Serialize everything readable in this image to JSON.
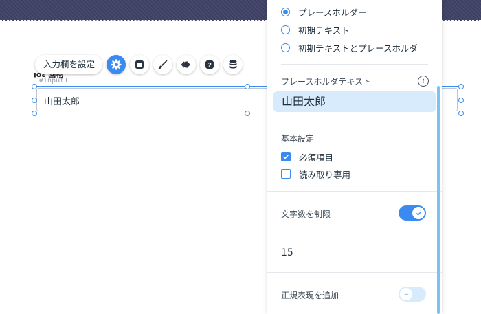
{
  "toolbar": {
    "label": "入力欄を設定",
    "buttons": [
      "settings",
      "layout",
      "design",
      "animation",
      "help",
      "connect-data"
    ]
  },
  "element": {
    "field_label": "ᴉoɛ 回物",
    "id": "#input1",
    "value": "山田太郎"
  },
  "panel": {
    "display_options": [
      {
        "label": "プレースホルダー",
        "checked": true
      },
      {
        "label": "初期テキスト",
        "checked": false
      },
      {
        "label": "初期テキストとプレースホルダ",
        "checked": false
      }
    ],
    "placeholder_section_label": "プレースホルダテキスト",
    "info_icon": "i",
    "placeholder_value": "山田太郎",
    "basic_settings_label": "基本設定",
    "checkboxes": [
      {
        "label": "必須項目",
        "checked": true
      },
      {
        "label": "読み取り専用",
        "checked": false
      }
    ],
    "limit_chars_label": "文字数を制限",
    "limit_chars_on": true,
    "limit_value": "15",
    "regex_label": "正規表現を追加",
    "regex_on": false
  },
  "colors": {
    "accent": "#3b8af0",
    "topbar": "#3d3f63",
    "placeholder_bg": "#d8ebfc"
  }
}
